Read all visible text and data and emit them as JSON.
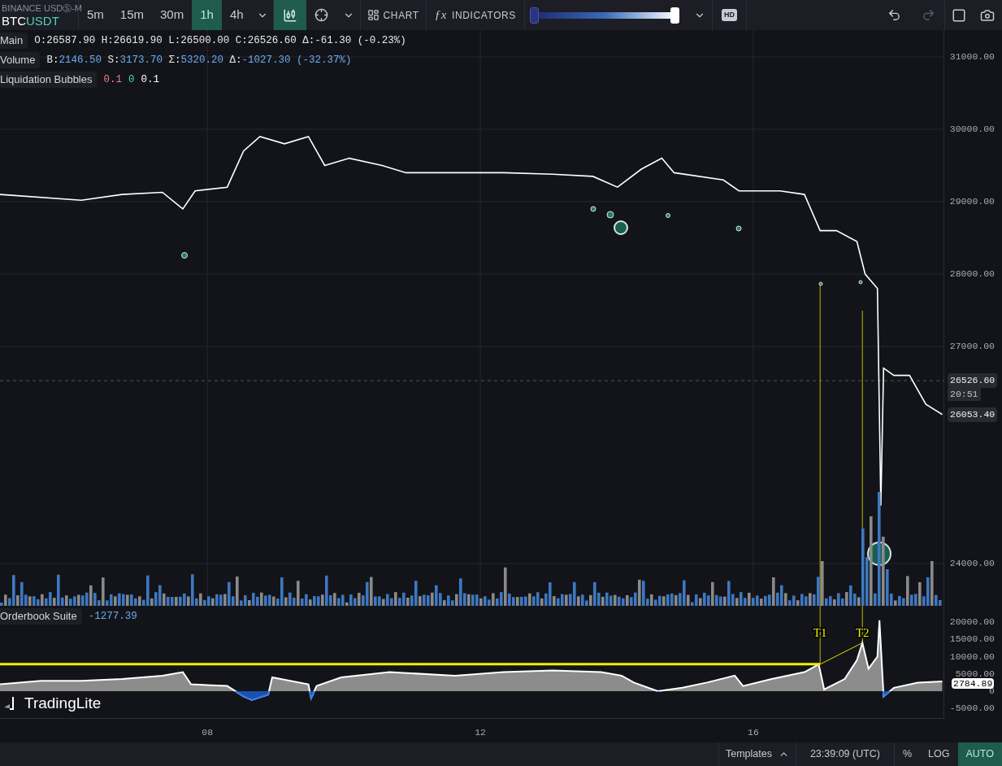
{
  "toolbar": {
    "symbol": {
      "exchange": "BINANCE USDⓈ-M",
      "base": "BTC",
      "quote": "USDT"
    },
    "timeframes": [
      {
        "label": "5m",
        "selected": false
      },
      {
        "label": "15m",
        "selected": false
      },
      {
        "label": "30m",
        "selected": false
      },
      {
        "label": "1h",
        "selected": true
      },
      {
        "label": "4h",
        "selected": false
      }
    ],
    "candle_button": {
      "selected": true
    },
    "chart_button": "CHART",
    "indicators_button": {
      "icon": "ƒx",
      "label": "INDICATORS"
    },
    "opacity_slider": {
      "level": 1
    },
    "hd_badge": "HD",
    "redo": {
      "disabled": true
    }
  },
  "legend": {
    "main": {
      "label": "Main",
      "text": "O:26587.90 H:26619.90 L:26500.00 C:26526.60 Δ:-61.30 (-0.23%)"
    },
    "volume": {
      "label": "Volume",
      "fields": [
        {
          "key": "B:",
          "value": "2146.50"
        },
        {
          "key": "S:",
          "value": "3173.70"
        },
        {
          "key": "Σ:",
          "value": "5320.20"
        },
        {
          "key": "Δ:",
          "value": "-1027.30 (-32.37%)"
        }
      ]
    },
    "liquidation": {
      "label": "Liquidation Bubbles",
      "values": [
        {
          "text": "0.1",
          "color": "#f07c8c"
        },
        {
          "text": "0",
          "color": "#4fd1b5"
        },
        {
          "text": "0.1",
          "color": "#ffffff"
        }
      ]
    }
  },
  "price_chart": {
    "chart_data": {
      "type": "line",
      "xlim": [
        4.96,
        18.8
      ],
      "ylim": [
        23416,
        31371
      ],
      "grid": true,
      "ref_lines": [
        {
          "axis": "y",
          "value": 26526.6,
          "color": "#555555"
        },
        {
          "axis": "x",
          "value": 16.98,
          "color": "#b8b800"
        },
        {
          "axis": "x",
          "value": 17.6,
          "color": "#b8b800"
        }
      ],
      "yticks": [
        {
          "value": 24000,
          "label": "24000.00"
        },
        {
          "value": 27000,
          "label": "27000.00"
        },
        {
          "value": 28000,
          "label": "28000.00"
        },
        {
          "value": 29000,
          "label": "29000.00"
        },
        {
          "value": 30000,
          "label": "30000.00"
        },
        {
          "value": 31000,
          "label": "31000.00"
        }
      ],
      "x": [
        4.96,
        6.15,
        6.75,
        7.34,
        7.64,
        7.82,
        8.29,
        8.53,
        8.77,
        9.13,
        9.48,
        9.72,
        10.08,
        10.56,
        10.91,
        11.63,
        12.34,
        13.06,
        13.65,
        14.01,
        14.36,
        14.66,
        14.84,
        15.56,
        15.79,
        16.39,
        16.75,
        16.98,
        17.22,
        17.52,
        17.64,
        17.82,
        17.87,
        17.91,
        18.06,
        18.29,
        18.53,
        18.77
      ],
      "series": [
        {
          "color": "#ffffff",
          "values": [
            29100,
            29020,
            29100,
            29130,
            28900,
            29150,
            29200,
            29700,
            29900,
            29800,
            29900,
            29500,
            29600,
            29500,
            29400,
            29400,
            29400,
            29380,
            29350,
            29200,
            29450,
            29600,
            29400,
            29300,
            29150,
            29150,
            29100,
            28600,
            28600,
            28450,
            28000,
            27800,
            24800,
            26700,
            26600,
            26600,
            26200,
            26060
          ]
        }
      ]
    },
    "tags": [
      {
        "price": "26526.60",
        "time": "20:51"
      },
      {
        "price": "26053.40"
      }
    ]
  },
  "orderbook": {
    "reading": "-1277.39",
    "chart_data": {
      "type": "area",
      "xlim": [
        4.96,
        18.8
      ],
      "ylim": [
        -7760,
        24706
      ],
      "xticks": [
        {
          "value": 8,
          "label": "08"
        },
        {
          "value": 12,
          "label": "12"
        },
        {
          "value": 16,
          "label": "16"
        }
      ],
      "yticks": [
        {
          "value": -5000,
          "label": "-5000.00"
        },
        {
          "value": 0,
          "label": "0"
        },
        {
          "value": 5000,
          "label": "5000.00"
        },
        {
          "value": 10000,
          "label": "10000.00"
        },
        {
          "value": 15000,
          "label": "15000.00"
        },
        {
          "value": 20000,
          "label": "20000.00"
        }
      ],
      "x": [
        4.96,
        5.56,
        6.15,
        6.75,
        7.34,
        7.64,
        7.76,
        8.29,
        8.53,
        8.65,
        8.89,
        8.95,
        9.48,
        9.52,
        9.6,
        9.96,
        10.67,
        11.63,
        12.34,
        13.06,
        13.77,
        14.07,
        14.25,
        14.6,
        14.96,
        15.32,
        15.73,
        15.85,
        16.27,
        16.75,
        16.96,
        17.04,
        17.34,
        17.52,
        17.6,
        17.69,
        17.82,
        17.85,
        17.91,
        18.06,
        18.41,
        18.77
      ],
      "series": [
        {
          "name": "Orderbook Suite",
          "color": "#8c8c8c",
          "values": [
            2000,
            3000,
            3000,
            3500,
            4500,
            5500,
            2000,
            1500,
            -1500,
            -2500,
            -1000,
            4000,
            2000,
            -2000,
            1500,
            4000,
            5500,
            4500,
            5500,
            6000,
            5500,
            4500,
            2500,
            0,
            1000,
            2500,
            4500,
            1500,
            3500,
            5500,
            7800,
            500,
            3500,
            9000,
            14000,
            6500,
            10000,
            20500,
            -1500,
            1000,
            2500,
            2800
          ]
        }
      ],
      "ref_lines": [
        {
          "axis": "x",
          "value": 16.98,
          "color": "#b8b800"
        },
        {
          "axis": "x",
          "value": 17.6,
          "color": "#b8b800"
        },
        {
          "axis": "y",
          "value": 7800,
          "color": "#f0f000"
        }
      ],
      "annotations": [
        {
          "text": "T1",
          "x": 16.98,
          "y": 7800
        },
        {
          "text": "T2",
          "x": 17.6,
          "y": 14000
        }
      ]
    },
    "tag": "2784.89"
  },
  "logo": "TradingLite",
  "status_bar": {
    "templates": "Templates",
    "clock": "23:39:09 (UTC)",
    "scale_buttons": [
      {
        "label": "%",
        "selected": false
      },
      {
        "label": "LOG",
        "selected": false
      },
      {
        "label": "AUTO",
        "selected": true
      }
    ]
  }
}
